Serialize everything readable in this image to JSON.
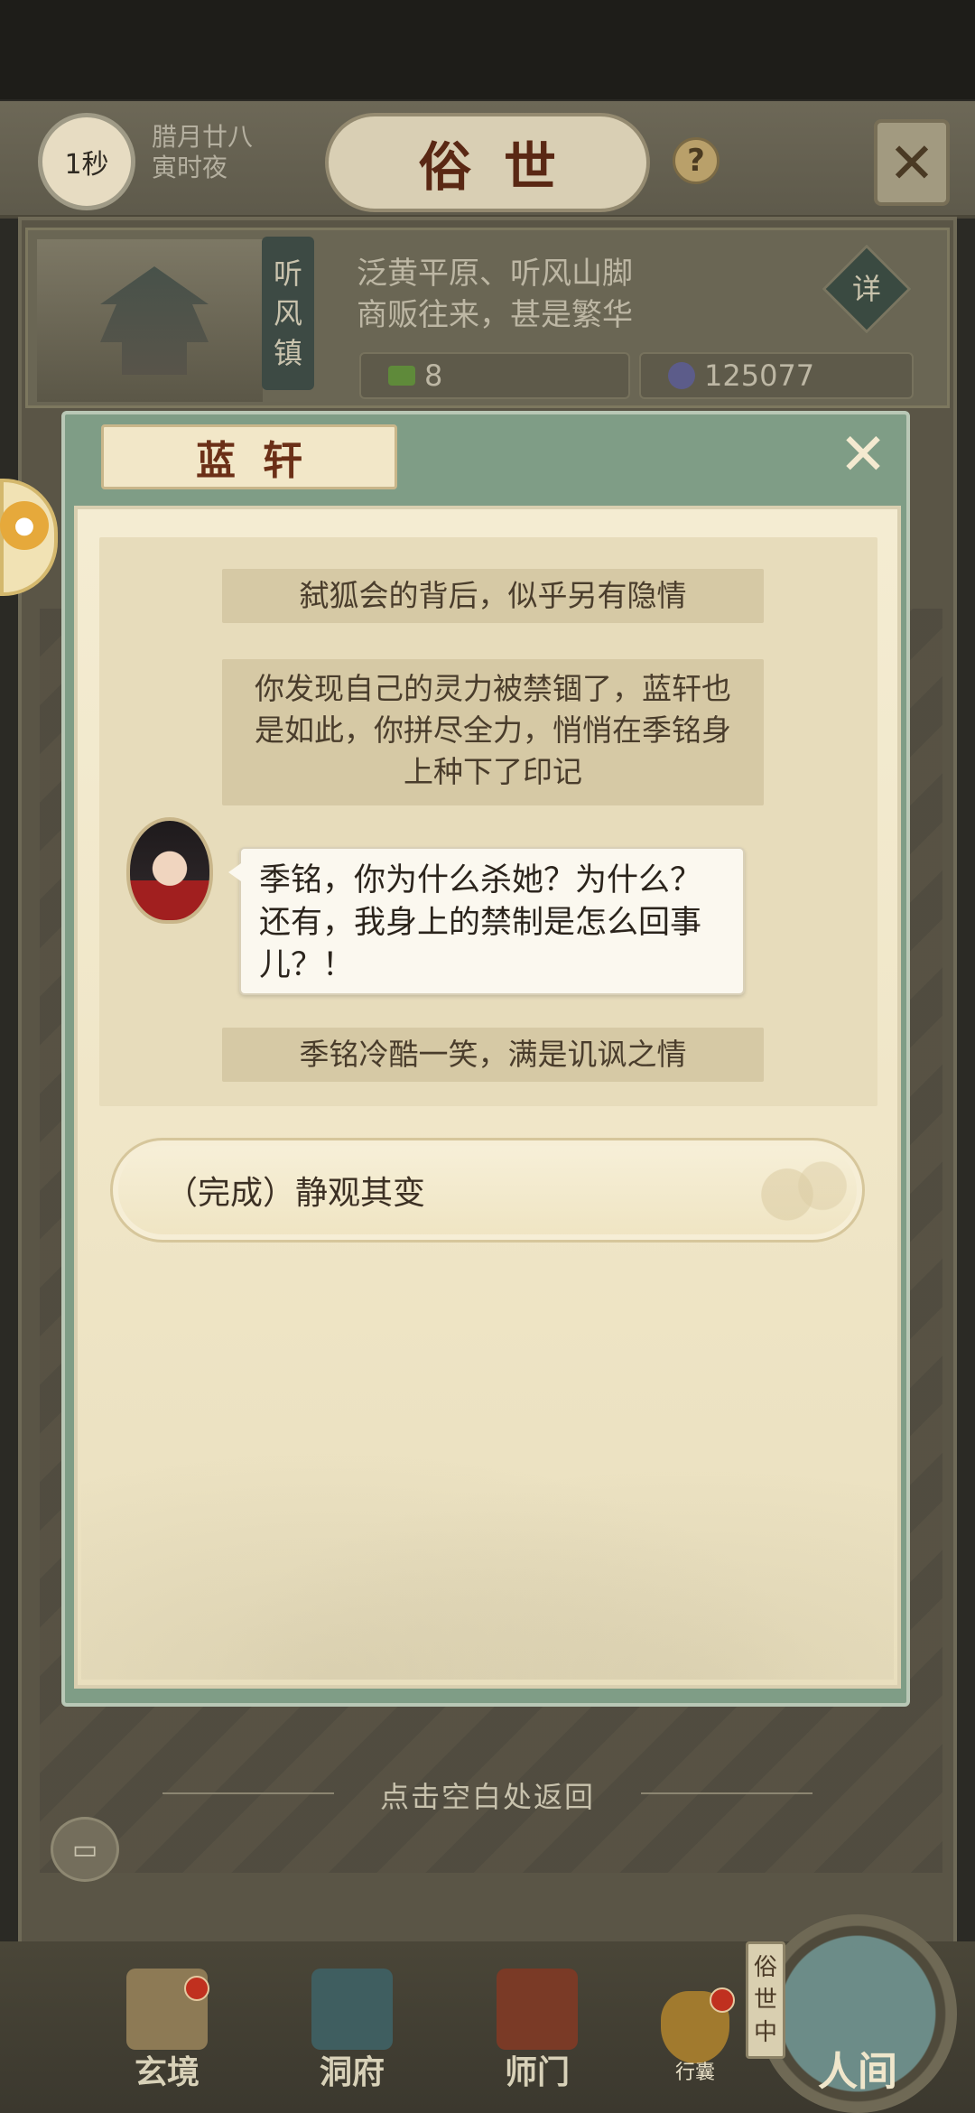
{
  "header": {
    "time_badge": "1秒",
    "date_line1": "腊月廿八",
    "date_line2": "寅时夜",
    "title": "俗世",
    "help_symbol": "?",
    "close_symbol": "✕"
  },
  "location": {
    "name_chars": [
      "听",
      "风",
      "镇"
    ],
    "desc_line1": "泛黄平原、听风山脚",
    "desc_line2": "商贩往来，甚是繁华",
    "detail_label": "详",
    "resource_green": "8",
    "resource_blue": "125077"
  },
  "dialog": {
    "title": "蓝轩",
    "close_symbol": "✕",
    "narration_1": "弑狐会的背后，似乎另有隐情",
    "narration_2": "你发现自己的灵力被禁锢了，蓝轩也是如此，你拼尽全力，悄悄在季铭身上种下了印记",
    "speech": "季铭，你为什么杀她？为什么？还有，我身上的禁制是怎么回事儿？！",
    "narration_3": "季铭冷酷一笑，满是讥讽之情",
    "choice": "（完成）静观其变"
  },
  "hint": "点击空白处返回",
  "bottom_nav": {
    "items": [
      "玄境",
      "洞府",
      "师门"
    ],
    "purse_label": "行囊",
    "main_label": "人间",
    "tag_chars": [
      "俗",
      "世",
      "中"
    ]
  },
  "colors": {
    "dialog_frame": "#7f9d86",
    "parchment": "#f4ecd2",
    "title_red": "#6b2f17",
    "badge_red": "#c0301f"
  }
}
